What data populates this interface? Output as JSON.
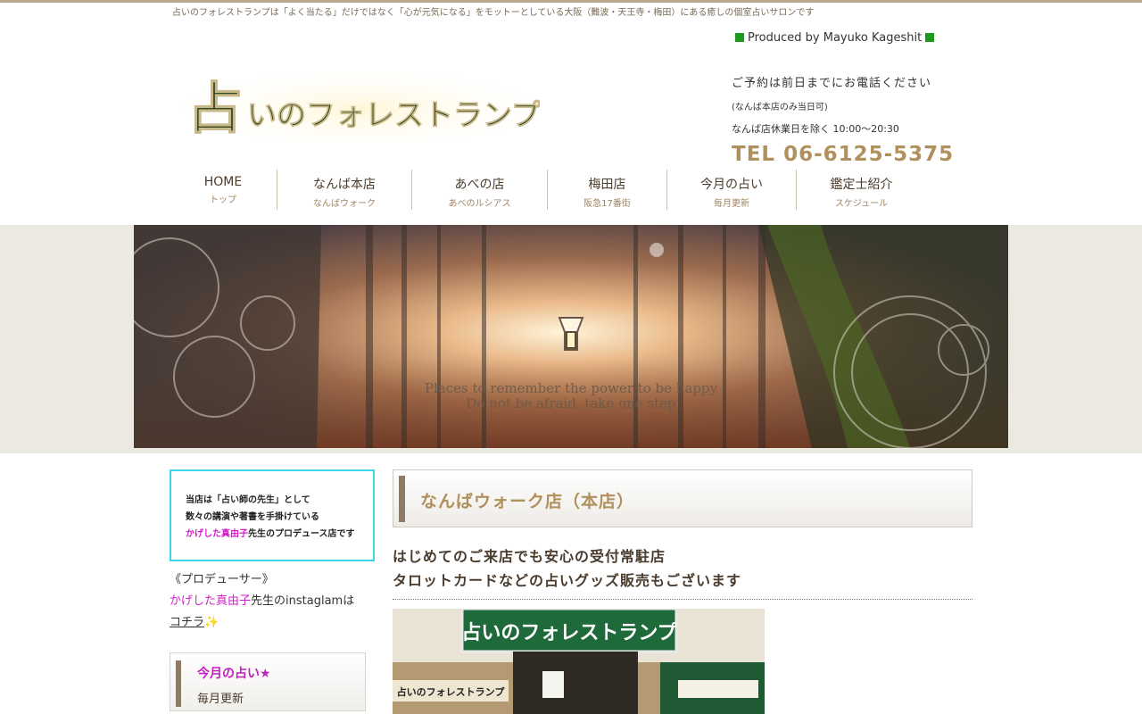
{
  "header": {
    "tagline": "占いのフォレストランプは「よく当たる」だけではなく「心が元気になる」をモットーとしている大阪（難波・天王寺・梅田）にある癒しの個室占いサロンです",
    "produced_by": "Produced by Mayuko Kageshit",
    "logo_text": "占いのフォレストランプ"
  },
  "contact": {
    "line1": "ご予約は前日までにお電話ください",
    "line2": "(なんば本店のみ当日可)",
    "line3": "なんば店休業日を除く 10:00〜20:30",
    "tel": "TEL 06-6125-5375"
  },
  "nav": {
    "items": [
      {
        "en": "HOME",
        "jp": "トップ"
      },
      {
        "en": "なんば本店",
        "jp": "なんばウォーク"
      },
      {
        "en": "あべの店",
        "jp": "あべのルシアス"
      },
      {
        "en": "梅田店",
        "jp": "阪急17番街"
      },
      {
        "en": "今月の占い",
        "jp": "毎月更新"
      },
      {
        "en": "鑑定士紹介",
        "jp": "スケジュール"
      }
    ]
  },
  "hero": {
    "line1": "Places to remember the power to be happy",
    "line2": "Do not be afraid, take one step"
  },
  "sidebar": {
    "box_line1": "当店は「占い師の先生」として",
    "box_line2": "数々の講演や著書を手掛けている",
    "box_line3_name": "かげした真由子",
    "box_line3_rest": "先生のプロデュース店です",
    "producer_label": "《プロデューサー》",
    "producer_name": "かげした真由子",
    "producer_rest": "先生のinstaglamは",
    "producer_link": "コチラ",
    "producer_emoji": "✨",
    "card_title": "今月の占い★",
    "card_sub": "毎月更新"
  },
  "main": {
    "title": "なんばウォーク店（本店）",
    "lead1": "はじめてのご来店でも安心の受付常駐店",
    "lead2": "タロットカードなどの占いグッズ販売もございます",
    "sign_text": "占いのフォレストランプ",
    "sign_small": "占いのフォレストランプ"
  },
  "colors": {
    "accent_gold": "#b0905c",
    "brown": "#8f7b63",
    "magenta": "#d21ec8",
    "cyan_border": "#3fd7e6",
    "green": "#1c9a1c"
  }
}
